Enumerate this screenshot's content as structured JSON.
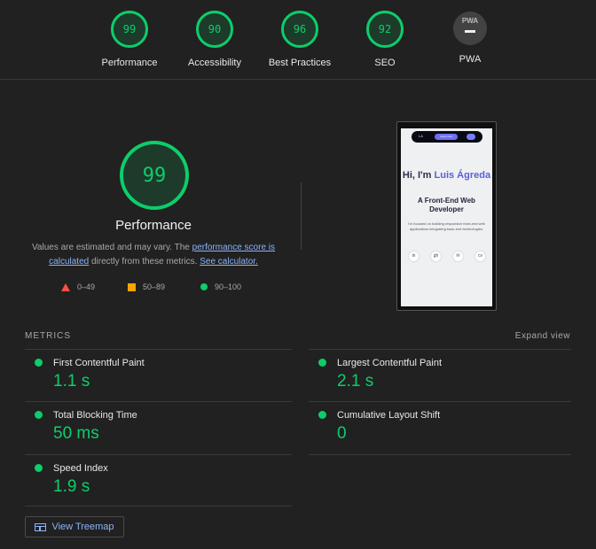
{
  "gauges": [
    {
      "score": "99",
      "label": "Performance"
    },
    {
      "score": "90",
      "label": "Accessibility"
    },
    {
      "score": "96",
      "label": "Best Practices"
    },
    {
      "score": "92",
      "label": "SEO"
    },
    {
      "badge": "PWA",
      "label": "PWA"
    }
  ],
  "performance": {
    "score": "99",
    "title": "Performance",
    "desc_prefix": "Values are estimated and may vary. The ",
    "desc_link1": "performance score is calculated",
    "desc_middle": " directly from these metrics. ",
    "desc_link2": "See calculator."
  },
  "legend": [
    {
      "range": "0–49",
      "color": "#ff4e42",
      "shape": "triangle"
    },
    {
      "range": "50–89",
      "color": "#ffa400",
      "shape": "square"
    },
    {
      "range": "90–100",
      "color": "#0cce6b",
      "shape": "circle"
    }
  ],
  "preview": {
    "nav_logo": "LA",
    "nav_button": "Lorem text",
    "hero_prefix": "Hi, I'm ",
    "hero_name": "Luis Ágreda",
    "subtitle": "A Front-End Web Developer",
    "paragraph": "I'm focused on building responsive front-end web applications integrating back-end technologies.",
    "icons": [
      "in",
      "gh",
      "✉",
      "cv"
    ]
  },
  "metrics": {
    "header": "METRICS",
    "expand": "Expand view",
    "items": [
      {
        "name": "First Contentful Paint",
        "value": "1.1 s"
      },
      {
        "name": "Largest Contentful Paint",
        "value": "2.1 s"
      },
      {
        "name": "Total Blocking Time",
        "value": "50 ms"
      },
      {
        "name": "Cumulative Layout Shift",
        "value": "0"
      },
      {
        "name": "Speed Index",
        "value": "1.9 s"
      }
    ]
  },
  "treemap": {
    "label": "View Treemap"
  },
  "colors": {
    "pass": "#0cce6b",
    "link": "#8ab4f8",
    "background": "#212121"
  }
}
